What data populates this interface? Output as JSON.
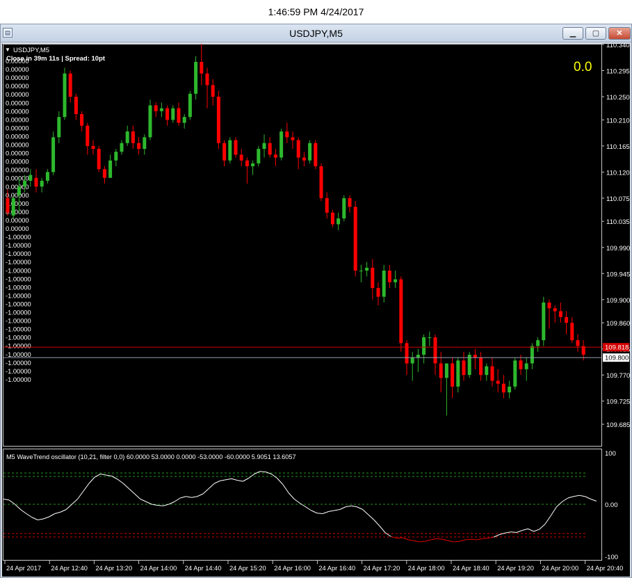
{
  "clock": "1:46:59 PM 4/24/2017",
  "window": {
    "title": "USDJPY,M5"
  },
  "chart_header": {
    "symbol": "USDJPY,M5",
    "info": "Close in 39m 11s | Spread: 10pt",
    "value_display": "0.0"
  },
  "colors": {
    "bull": "#2db82d",
    "bear": "#ff0000",
    "bid_line": "#d40000",
    "ask_line": "#9aa0b5",
    "wave": "#ffffff",
    "wave_low": "#e00000",
    "level_high": "#1e9a1e",
    "level_low": "#d40000"
  },
  "left_labels": {
    "positive": "0.00000",
    "negative": "-1.00000"
  },
  "price_axis": [
    "110.340",
    "110.295",
    "110.250",
    "110.210",
    "110.165",
    "110.120",
    "110.075",
    "110.035",
    "109.990",
    "109.945",
    "109.900",
    "109.860",
    "109.815",
    "109.770",
    "109.725",
    "109.685"
  ],
  "bid_price": "109.818",
  "ask_price": "109.800",
  "time_axis": [
    "24 Apr 2017",
    "24 Apr 12:40",
    "24 Apr 13:20",
    "24 Apr 14:00",
    "24 Apr 14:40",
    "24 Apr 15:20",
    "24 Apr 16:00",
    "24 Apr 16:40",
    "24 Apr 17:20",
    "24 Apr 18:00",
    "24 Apr 18:40",
    "24 Apr 19:20",
    "24 Apr 20:00",
    "24 Apr 20:40"
  ],
  "indicator": {
    "label": "M5 WaveTrend oscillator (10,21, filter 0,0) 60.0000 53.0000 0.0000 -53.0000 -60.0000 5.9051 13.6057",
    "axis": [
      "100",
      "0.00",
      "-100"
    ]
  },
  "chart_data": {
    "type": "candlestick",
    "symbol": "USDJPY",
    "timeframe": "M5",
    "ylim": [
      109.68,
      110.36
    ],
    "candles": [
      [
        110.075,
        110.09,
        110.045,
        110.05
      ],
      [
        110.045,
        110.08,
        110.04,
        110.075
      ],
      [
        110.08,
        110.11,
        110.05,
        110.095
      ],
      [
        110.095,
        110.115,
        110.085,
        110.105
      ],
      [
        110.105,
        110.125,
        110.095,
        110.115
      ],
      [
        110.11,
        110.125,
        110.085,
        110.095
      ],
      [
        110.095,
        110.11,
        110.085,
        110.105
      ],
      [
        110.105,
        110.125,
        110.1,
        110.12
      ],
      [
        110.12,
        110.19,
        110.115,
        110.18
      ],
      [
        110.18,
        110.225,
        110.17,
        110.215
      ],
      [
        110.215,
        110.3,
        110.21,
        110.29
      ],
      [
        110.29,
        110.295,
        110.24,
        110.25
      ],
      [
        110.25,
        110.255,
        110.21,
        110.22
      ],
      [
        110.22,
        110.225,
        110.19,
        110.2
      ],
      [
        110.2,
        110.205,
        110.15,
        110.165
      ],
      [
        110.165,
        110.175,
        110.15,
        110.16
      ],
      [
        110.16,
        110.165,
        110.12,
        110.125
      ],
      [
        110.125,
        110.13,
        110.1,
        110.11
      ],
      [
        110.11,
        110.15,
        110.11,
        110.14
      ],
      [
        110.14,
        110.16,
        110.13,
        110.155
      ],
      [
        110.155,
        110.175,
        110.15,
        110.17
      ],
      [
        110.17,
        110.2,
        110.165,
        110.19
      ],
      [
        110.19,
        110.2,
        110.16,
        110.17
      ],
      [
        110.17,
        110.18,
        110.15,
        110.16
      ],
      [
        110.16,
        110.185,
        110.15,
        110.18
      ],
      [
        110.18,
        110.245,
        110.175,
        110.235
      ],
      [
        110.235,
        110.24,
        110.215,
        110.225
      ],
      [
        110.225,
        110.24,
        110.215,
        110.23
      ],
      [
        110.23,
        110.235,
        110.2,
        110.21
      ],
      [
        110.21,
        110.235,
        110.205,
        110.23
      ],
      [
        110.23,
        110.24,
        110.2,
        110.205
      ],
      [
        110.205,
        110.22,
        110.195,
        110.215
      ],
      [
        110.215,
        110.26,
        110.21,
        110.255
      ],
      [
        110.255,
        110.32,
        110.245,
        110.31
      ],
      [
        110.31,
        110.35,
        110.27,
        110.29
      ],
      [
        110.29,
        110.3,
        110.23,
        110.27
      ],
      [
        110.27,
        110.28,
        110.235,
        110.25
      ],
      [
        110.25,
        110.26,
        110.16,
        110.17
      ],
      [
        110.17,
        110.175,
        110.13,
        110.14
      ],
      [
        110.14,
        110.18,
        110.135,
        110.175
      ],
      [
        110.175,
        110.18,
        110.145,
        110.15
      ],
      [
        110.15,
        110.16,
        110.13,
        110.14
      ],
      [
        110.14,
        110.145,
        110.1,
        110.13
      ],
      [
        110.13,
        110.14,
        110.115,
        110.135
      ],
      [
        110.135,
        110.165,
        110.13,
        110.16
      ],
      [
        110.16,
        110.185,
        110.145,
        110.17
      ],
      [
        110.17,
        110.18,
        110.145,
        110.15
      ],
      [
        110.15,
        110.16,
        110.13,
        110.145
      ],
      [
        110.145,
        110.195,
        110.14,
        110.19
      ],
      [
        110.19,
        110.205,
        110.17,
        110.18
      ],
      [
        110.18,
        110.19,
        110.16,
        110.175
      ],
      [
        110.175,
        110.18,
        110.125,
        110.145
      ],
      [
        110.145,
        110.155,
        110.13,
        110.14
      ],
      [
        110.14,
        110.175,
        110.135,
        110.17
      ],
      [
        110.17,
        110.175,
        110.125,
        110.13
      ],
      [
        110.13,
        110.135,
        110.07,
        110.075
      ],
      [
        110.075,
        110.085,
        110.04,
        110.05
      ],
      [
        110.05,
        110.055,
        110.025,
        110.03
      ],
      [
        110.03,
        110.05,
        110.02,
        110.04
      ],
      [
        110.04,
        110.08,
        110.035,
        110.075
      ],
      [
        110.075,
        110.08,
        110.05,
        110.06
      ],
      [
        110.06,
        110.07,
        109.94,
        109.95
      ],
      [
        109.95,
        109.96,
        109.93,
        109.95
      ],
      [
        109.95,
        109.965,
        109.94,
        109.955
      ],
      [
        109.955,
        109.97,
        109.9,
        109.92
      ],
      [
        109.92,
        109.93,
        109.89,
        109.905
      ],
      [
        109.905,
        109.96,
        109.895,
        109.95
      ],
      [
        109.95,
        109.96,
        109.92,
        109.93
      ],
      [
        109.93,
        109.95,
        109.92,
        109.935
      ],
      [
        109.935,
        109.94,
        109.81,
        109.825
      ],
      [
        109.825,
        109.83,
        109.77,
        109.79
      ],
      [
        109.79,
        109.81,
        109.76,
        109.8
      ],
      [
        109.8,
        109.815,
        109.775,
        109.805
      ],
      [
        109.805,
        109.84,
        109.79,
        109.835
      ],
      [
        109.835,
        109.845,
        109.82,
        109.835
      ],
      [
        109.835,
        109.84,
        109.77,
        109.79
      ],
      [
        109.79,
        109.81,
        109.74,
        109.765
      ],
      [
        109.765,
        109.79,
        109.7,
        109.79
      ],
      [
        109.79,
        109.8,
        109.73,
        109.75
      ],
      [
        109.75,
        109.8,
        109.74,
        109.795
      ],
      [
        109.795,
        109.81,
        109.76,
        109.77
      ],
      [
        109.77,
        109.81,
        109.765,
        109.805
      ],
      [
        109.805,
        109.815,
        109.78,
        109.8
      ],
      [
        109.8,
        109.81,
        109.76,
        109.77
      ],
      [
        109.77,
        109.79,
        109.76,
        109.785
      ],
      [
        109.785,
        109.8,
        109.75,
        109.76
      ],
      [
        109.76,
        109.78,
        109.74,
        109.755
      ],
      [
        109.755,
        109.77,
        109.73,
        109.74
      ],
      [
        109.74,
        109.76,
        109.73,
        109.75
      ],
      [
        109.75,
        109.8,
        109.745,
        109.795
      ],
      [
        109.795,
        109.805,
        109.77,
        109.78
      ],
      [
        109.78,
        109.8,
        109.76,
        109.79
      ],
      [
        109.79,
        109.825,
        109.78,
        109.82
      ],
      [
        109.82,
        109.835,
        109.81,
        109.83
      ],
      [
        109.83,
        109.905,
        109.82,
        109.895
      ],
      [
        109.895,
        109.9,
        109.85,
        109.885
      ],
      [
        109.885,
        109.89,
        109.86,
        109.88
      ],
      [
        109.88,
        109.895,
        109.86,
        109.87
      ],
      [
        109.87,
        109.88,
        109.84,
        109.86
      ],
      [
        109.86,
        109.87,
        109.825,
        109.83
      ],
      [
        109.83,
        109.84,
        109.81,
        109.82
      ],
      [
        109.82,
        109.83,
        109.795,
        109.805
      ]
    ],
    "wavetrend": [
      10,
      8,
      0,
      -10,
      -18,
      -25,
      -30,
      -28,
      -24,
      -18,
      -15,
      -10,
      0,
      10,
      25,
      40,
      52,
      58,
      56,
      54,
      48,
      40,
      30,
      20,
      10,
      5,
      0,
      -2,
      -3,
      0,
      5,
      12,
      15,
      13,
      15,
      20,
      30,
      40,
      45,
      47,
      49,
      46,
      44,
      50,
      58,
      63,
      62,
      58,
      50,
      38,
      22,
      10,
      2,
      -5,
      -12,
      -17,
      -18,
      -14,
      -12,
      -10,
      -5,
      -3,
      -5,
      -10,
      -20,
      -30,
      -42,
      -55,
      -62,
      -65,
      -64,
      -68,
      -70,
      -72,
      -71,
      -68,
      -66,
      -67,
      -70,
      -72,
      -71,
      -68,
      -67,
      -68,
      -66,
      -65,
      -63,
      -58,
      -55,
      -53,
      -54,
      -50,
      -47,
      -52,
      -48,
      -38,
      -22,
      -5,
      5,
      12,
      15,
      17,
      15,
      10,
      6
    ]
  }
}
